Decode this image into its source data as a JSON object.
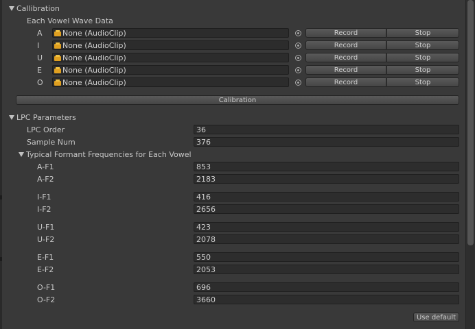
{
  "calibration": {
    "header": "Callibration",
    "each_vowel_label": "Each Vowel Wave Data",
    "vowels": [
      {
        "name": "A",
        "clip": "None (AudioClip)",
        "record": "Record",
        "stop": "Stop"
      },
      {
        "name": "I",
        "clip": "None (AudioClip)",
        "record": "Record",
        "stop": "Stop"
      },
      {
        "name": "U",
        "clip": "None (AudioClip)",
        "record": "Record",
        "stop": "Stop"
      },
      {
        "name": "E",
        "clip": "None (AudioClip)",
        "record": "Record",
        "stop": "Stop"
      },
      {
        "name": "O",
        "clip": "None (AudioClip)",
        "record": "Record",
        "stop": "Stop"
      }
    ],
    "calibrate_button": "Calibration"
  },
  "lpc": {
    "header": "LPC Parameters",
    "order_label": "LPC Order",
    "order_value": "36",
    "sample_label": "Sample Num",
    "sample_value": "376",
    "formant_header": "Typical Formant Frequencies for Each Vowel",
    "formants": [
      {
        "label": "A-F1",
        "value": "853"
      },
      {
        "label": "A-F2",
        "value": "2183"
      },
      {
        "label": "I-F1",
        "value": "416"
      },
      {
        "label": "I-F2",
        "value": "2656"
      },
      {
        "label": "U-F1",
        "value": "423"
      },
      {
        "label": "U-F2",
        "value": "2078"
      },
      {
        "label": "E-F1",
        "value": "550"
      },
      {
        "label": "E-F2",
        "value": "2053"
      },
      {
        "label": "O-F1",
        "value": "696"
      },
      {
        "label": "O-F2",
        "value": "3660"
      }
    ],
    "use_default_button": "Use default"
  },
  "icons": {
    "foldout": "triangle-down-icon",
    "clip": "audio-clip-icon",
    "picker": "object-picker-icon"
  },
  "colors": {
    "background": "#393939",
    "field": "#2c2c2c",
    "text": "#c8c8c8",
    "clip_icon": "#e0a020"
  }
}
